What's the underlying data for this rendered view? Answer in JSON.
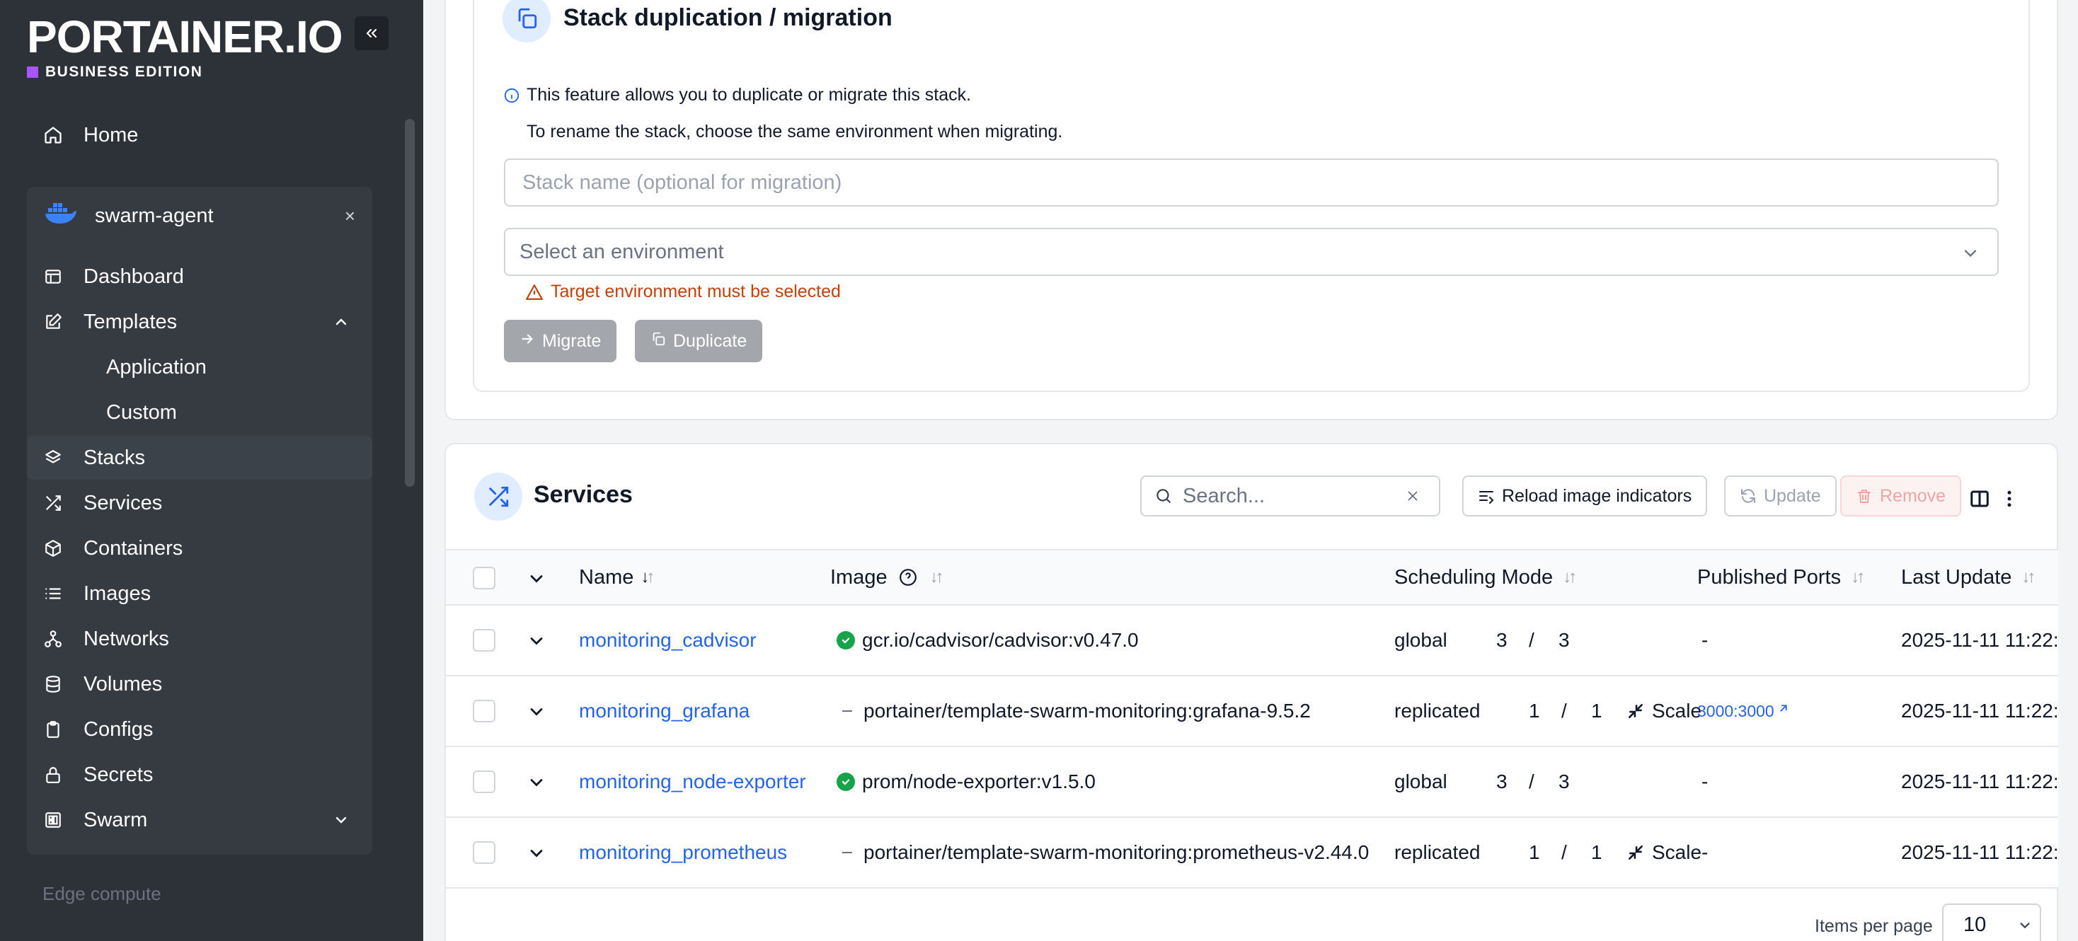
{
  "brand": {
    "logo": "PORTAINER.IO",
    "edition": "BUSINESS EDITION"
  },
  "sidebar": {
    "home": "Home",
    "environment": {
      "name": "swarm-agent",
      "close": "×"
    },
    "items": [
      {
        "label": "Dashboard"
      },
      {
        "label": "Templates"
      },
      {
        "label": "Application"
      },
      {
        "label": "Custom"
      },
      {
        "label": "Stacks"
      },
      {
        "label": "Services"
      },
      {
        "label": "Containers"
      },
      {
        "label": "Images"
      },
      {
        "label": "Networks"
      },
      {
        "label": "Volumes"
      },
      {
        "label": "Configs"
      },
      {
        "label": "Secrets"
      },
      {
        "label": "Swarm"
      }
    ],
    "edge_compute": "Edge compute"
  },
  "duplication": {
    "title": "Stack duplication / migration",
    "info1": "This feature allows you to duplicate or migrate this stack.",
    "info2": "To rename the stack, choose the same environment when migrating.",
    "name_placeholder": "Stack name (optional for migration)",
    "env_placeholder": "Select an environment",
    "warning": "Target environment must be selected",
    "migrate_label": "Migrate",
    "duplicate_label": "Duplicate"
  },
  "services": {
    "title": "Services",
    "search_placeholder": "Search...",
    "reload_label": "Reload image indicators",
    "update_label": "Update",
    "remove_label": "Remove",
    "columns": {
      "name": "Name",
      "image": "Image",
      "scheduling": "Scheduling Mode",
      "ports": "Published Ports",
      "updated": "Last Update"
    },
    "rows": [
      {
        "name": "monitoring_cadvisor",
        "image": "gcr.io/cadvisor/cadvisor:v0.47.0",
        "status": "ok",
        "mode": "global",
        "running": "3",
        "sep": "/",
        "desired": "3",
        "scale": "",
        "port": "-",
        "updated": "2025-11-11 11:22:"
      },
      {
        "name": "monitoring_grafana",
        "image": "portainer/template-swarm-monitoring:grafana-9.5.2",
        "status": "none",
        "mode": "replicated",
        "running": "1",
        "sep": "/",
        "desired": "1",
        "scale": "Scale",
        "port": "3000:3000",
        "updated": "2025-11-11 11:22:"
      },
      {
        "name": "monitoring_node-exporter",
        "image": "prom/node-exporter:v1.5.0",
        "status": "ok",
        "mode": "global",
        "running": "3",
        "sep": "/",
        "desired": "3",
        "scale": "",
        "port": "-",
        "updated": "2025-11-11 11:22:"
      },
      {
        "name": "monitoring_prometheus",
        "image": "portainer/template-swarm-monitoring:prometheus-v2.44.0",
        "status": "none",
        "mode": "replicated",
        "running": "1",
        "sep": "/",
        "desired": "1",
        "scale": "Scale",
        "port": "-",
        "updated": "2025-11-11 11:22:"
      }
    ],
    "items_per_page_label": "Items per page",
    "items_per_page": "10"
  }
}
